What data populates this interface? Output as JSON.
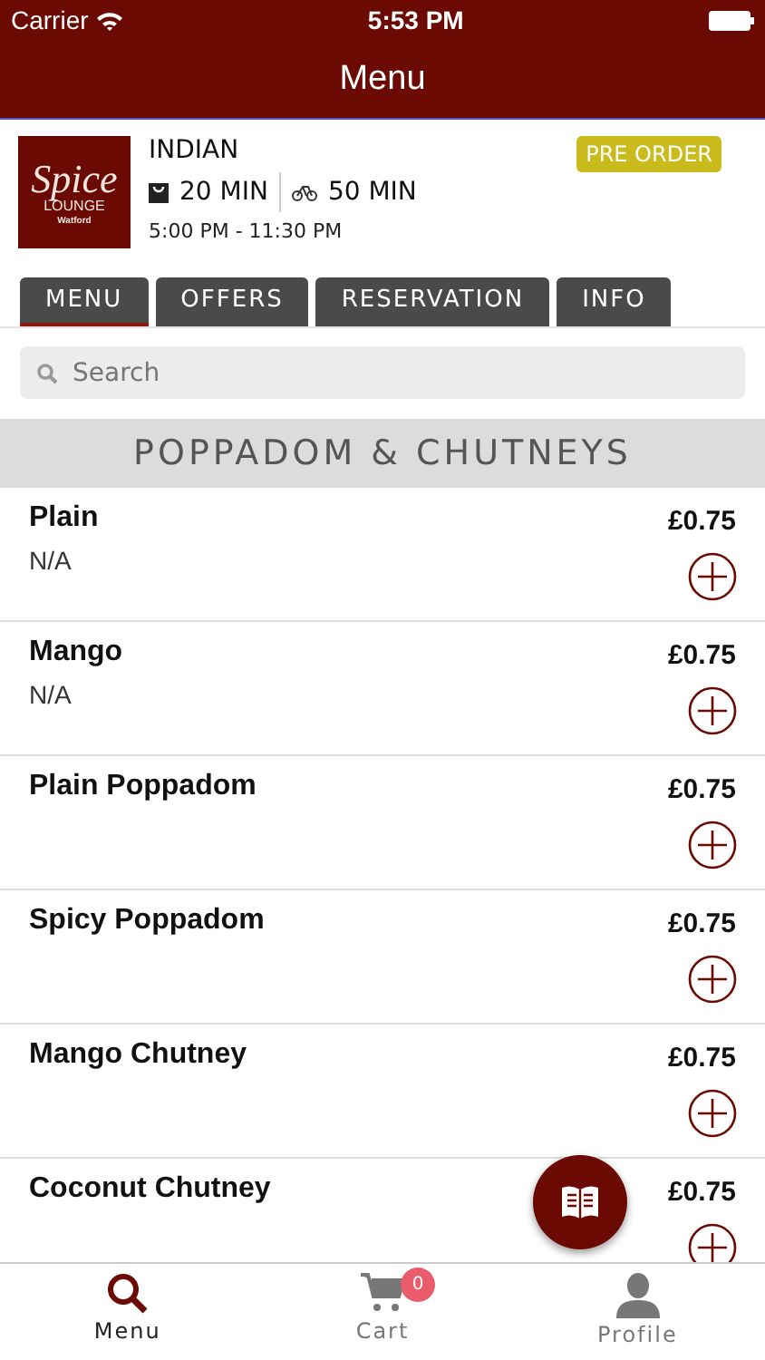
{
  "status_bar": {
    "carrier": "Carrier",
    "time": "5:53 PM"
  },
  "nav": {
    "title": "Menu"
  },
  "restaurant": {
    "logo": {
      "name": "Spice",
      "sub": "LOUNGE",
      "place": "Watford"
    },
    "cuisine": "INDIAN",
    "collection_time": "20 MIN",
    "delivery_time": "50 MIN",
    "hours": "5:00 PM - 11:30 PM",
    "badge": "PRE ORDER"
  },
  "tabs": [
    {
      "label": "MENU",
      "selected": true
    },
    {
      "label": "OFFERS",
      "selected": false
    },
    {
      "label": "RESERVATION",
      "selected": false
    },
    {
      "label": "INFO",
      "selected": false
    }
  ],
  "search": {
    "placeholder": "Search"
  },
  "section": {
    "title": "POPPADOM & CHUTNEYS"
  },
  "items": [
    {
      "name": "Plain",
      "description": "N/A",
      "price": "£0.75"
    },
    {
      "name": "Mango",
      "description": "N/A",
      "price": "£0.75"
    },
    {
      "name": "Plain Poppadom",
      "price": "£0.75"
    },
    {
      "name": "Spicy Poppadom",
      "price": "£0.75"
    },
    {
      "name": "Mango Chutney",
      "price": "£0.75"
    },
    {
      "name": "Coconut Chutney",
      "price": "£0.75"
    }
  ],
  "tab_bar": [
    {
      "label": "Menu",
      "kind": "search",
      "selected": true
    },
    {
      "label": "Cart",
      "kind": "cart",
      "selected": false,
      "badge": "0"
    },
    {
      "label": "Profile",
      "kind": "person",
      "selected": false
    }
  ]
}
